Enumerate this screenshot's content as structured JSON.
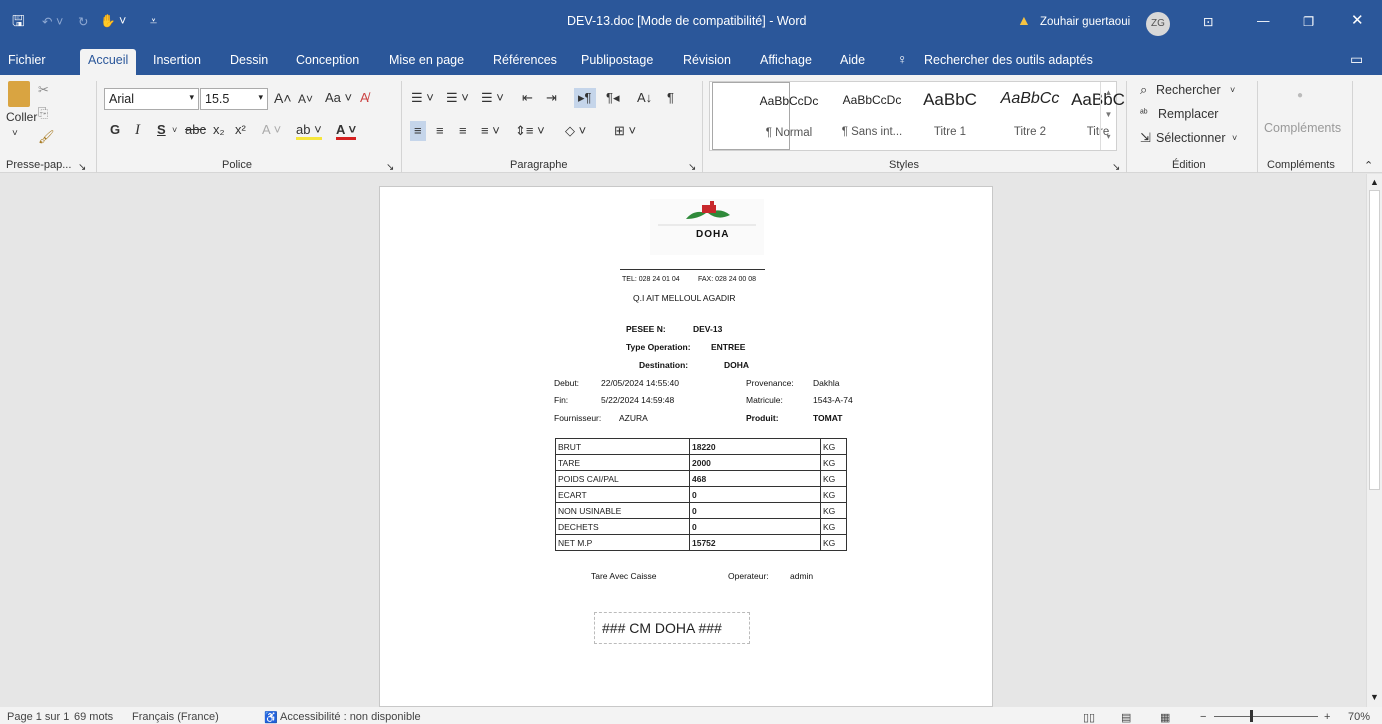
{
  "titlebar": {
    "doc_title": "DEV-13.doc [Mode de compatibilité]  -  Word",
    "user_name": "Zouhair guertaoui",
    "user_initials": "ZG"
  },
  "tabs": [
    "Fichier",
    "Accueil",
    "Insertion",
    "Dessin",
    "Conception",
    "Mise en page",
    "Références",
    "Publipostage",
    "Révision",
    "Affichage",
    "Aide"
  ],
  "search_tools": "Rechercher des outils adaptés",
  "ribbon": {
    "clipboard": {
      "paste": "Coller",
      "label": "Presse-pap..."
    },
    "font": {
      "name": "Arial",
      "size": "15.5",
      "label": "Police"
    },
    "paragraph": {
      "label": "Paragraphe"
    },
    "styles": {
      "label": "Styles",
      "items": [
        {
          "preview": "AaBbCcDc",
          "name": "¶ Normal"
        },
        {
          "preview": "AaBbCcDc",
          "name": "¶ Sans int..."
        },
        {
          "preview": "AaBbC",
          "name": "Titre 1"
        },
        {
          "preview": "AaBbCc",
          "name": "Titre 2"
        },
        {
          "preview": "AaBbC",
          "name": "Titre"
        }
      ]
    },
    "editing": {
      "find": "Rechercher",
      "replace": "Remplacer",
      "select": "Sélectionner",
      "label": "Édition"
    },
    "addins": {
      "button": "Compléments",
      "label": "Compléments"
    }
  },
  "document": {
    "logo_text": "DOHA",
    "tel": "TEL: 028 24 01 04",
    "fax": "FAX: 028 24 00 08",
    "address": "Q.I AIT MELLOUL AGADIR",
    "pesee_label": "PESEE N:",
    "pesee_value": "DEV-13",
    "type_label": "Type Operation:",
    "type_value": "ENTREE",
    "dest_label": "Destination:",
    "dest_value": "DOHA",
    "debut_label": "Debut:",
    "debut_value": "22/05/2024 14:55:40",
    "prov_label": "Provenance:",
    "prov_value": "Dakhla",
    "fin_label": "Fin:",
    "fin_value": "5/22/2024 14:59:48",
    "matricule_label": "Matricule:",
    "matricule_value": "1543-A-74",
    "fourn_label": "Fournisseur:",
    "fourn_value": "AZURA",
    "produit_label": "Produit:",
    "produit_value": "TOMAT",
    "weights": [
      {
        "label": "BRUT",
        "value": "18220",
        "unit": "KG"
      },
      {
        "label": "TARE",
        "value": "2000",
        "unit": "KG"
      },
      {
        "label": "POIDS CAI/PAL",
        "value": "468",
        "unit": "KG"
      },
      {
        "label": "ECART",
        "value": "0",
        "unit": "KG"
      },
      {
        "label": "NON USINABLE",
        "value": "0",
        "unit": "KG"
      },
      {
        "label": "DECHETS",
        "value": "0",
        "unit": "KG"
      },
      {
        "label": "NET M.P",
        "value": "15752",
        "unit": "KG"
      }
    ],
    "tare_note": "Tare Avec Caisse",
    "operator_label": "Operateur:",
    "operator_value": "admin",
    "footer_box": "### CM DOHA ###"
  },
  "status": {
    "page": "Page 1 sur 1",
    "words": "69 mots",
    "language": "Français (France)",
    "accessibility": "Accessibilité : non disponible",
    "zoom": "70%"
  }
}
